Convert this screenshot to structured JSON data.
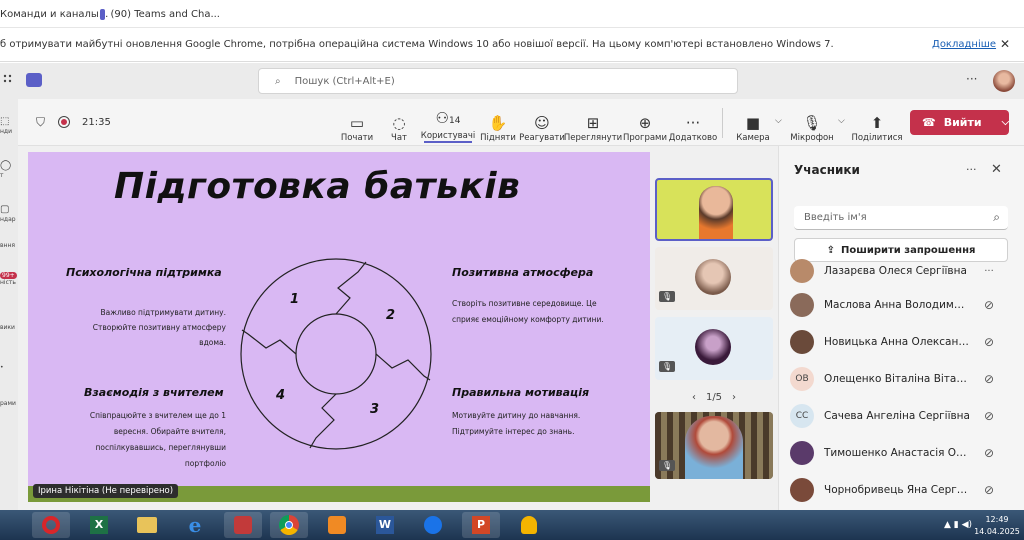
{
  "browser": {
    "tabs": [
      {
        "label": "Команди и каналы..."
      },
      {
        "label": "(90) Teams and Cha..."
      }
    ],
    "infobar": {
      "message": "б отримувати майбутні оновлення Google Chrome, потрібна операційна система Windows 10 або новішої версії. На цьому комп'ютері встановлено Windows 7.",
      "link": "Докладніше",
      "close": "✕"
    }
  },
  "teams": {
    "search": {
      "placeholder": "Пошук (Ctrl+Alt+E)"
    },
    "more": "···",
    "rail": [
      {
        "label": "нди"
      },
      {
        "label": "т"
      },
      {
        "label": "ндар"
      },
      {
        "label": "вння"
      },
      {
        "label": "ність",
        "badge": "99+"
      },
      {
        "label": "вики"
      },
      {
        "label": "•"
      },
      {
        "label": "рами"
      }
    ]
  },
  "meeting": {
    "time": "21:35",
    "people_count": "14",
    "toolbar": [
      {
        "label": "Почати",
        "icon": "share-icon"
      },
      {
        "label": "Чат",
        "icon": "chat-icon"
      },
      {
        "label": "Користувачі",
        "icon": "people-icon"
      },
      {
        "label": "Підняти",
        "icon": "hand-icon"
      },
      {
        "label": "Реагувати",
        "icon": "smile-icon"
      },
      {
        "label": "Переглянути",
        "icon": "grid-icon"
      },
      {
        "label": "Програми",
        "icon": "apps-icon"
      },
      {
        "label": "Додатково",
        "icon": "more-icon"
      },
      {
        "label": "Камера",
        "icon": "camera-icon"
      },
      {
        "label": "Мікрофон",
        "icon": "mic-off-icon"
      },
      {
        "label": "Поділитися",
        "icon": "upload-icon"
      }
    ],
    "leave_label": "Вийти",
    "presenter_label": "Ірина Нікітіна (Не перевірено)",
    "pager": "1/5"
  },
  "slide": {
    "title": "Підготовка батьків",
    "sections": [
      {
        "heading": "Психологічна підтримка",
        "text": "Важливо підтримувати дитину. Створюйте позитивну атмосферу вдома."
      },
      {
        "heading": "Позитивна атмосфера",
        "text": "Створіть позитивне середовище. Це сприяє емоційному комфорту дитини."
      },
      {
        "heading": "Взаємодія з вчителем",
        "text": "Співпрацюйте з вчителем ще до 1 вересня. Обирайте вчителя, поспілкувавшись, переглянувши портфоліо"
      },
      {
        "heading": "Правильна мотивація",
        "text": "Мотивуйте дитину до навчання. Підтримуйте інтерес до знань."
      }
    ],
    "numbers": [
      "1",
      "2",
      "3",
      "4"
    ]
  },
  "participants": {
    "title": "Учасники",
    "input_placeholder": "Введіть ім'я",
    "invite_label": "Поширити запрошення",
    "list": [
      {
        "name": "Лазарєва Олеся Сергіївна",
        "initials": "",
        "color": "#b88a6a"
      },
      {
        "name": "Маслова Анна Володимирі...",
        "initials": "",
        "color": "#8a6a5a"
      },
      {
        "name": "Новицька Анна Олександрі...",
        "initials": "",
        "color": "#6a4a3a"
      },
      {
        "name": "Олещенко Віталіна Віталіївна",
        "initials": "ОВ",
        "color": "#f3d9cf"
      },
      {
        "name": "Сачева Ангеліна Сергіївна",
        "initials": "СС",
        "color": "#d7e6f0"
      },
      {
        "name": "Тимошенко Анастасія Олек...",
        "initials": "",
        "color": "#5a3a6a"
      },
      {
        "name": "Чорнобривець Яна Сергіївна",
        "initials": "",
        "color": "#7a4a3a"
      }
    ]
  },
  "taskbar": {
    "time": "12:49",
    "date": "14.04.2025"
  }
}
